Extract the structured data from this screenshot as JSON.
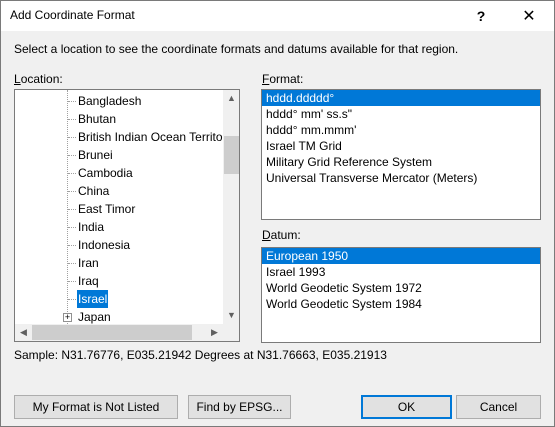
{
  "window": {
    "title": "Add Coordinate Format",
    "help": "?",
    "close": "✕"
  },
  "instruction": "Select a location to see the coordinate formats and datums available for that region.",
  "location": {
    "label_mnemonic": "L",
    "label_rest": "ocation:",
    "items": [
      {
        "label": "Bangladesh",
        "selected": false,
        "expandable": false
      },
      {
        "label": "Bhutan",
        "selected": false,
        "expandable": false
      },
      {
        "label": "British Indian Ocean Territo",
        "selected": false,
        "expandable": false
      },
      {
        "label": "Brunei",
        "selected": false,
        "expandable": false
      },
      {
        "label": "Cambodia",
        "selected": false,
        "expandable": false
      },
      {
        "label": "China",
        "selected": false,
        "expandable": false
      },
      {
        "label": "East Timor",
        "selected": false,
        "expandable": false
      },
      {
        "label": "India",
        "selected": false,
        "expandable": false
      },
      {
        "label": "Indonesia",
        "selected": false,
        "expandable": false
      },
      {
        "label": "Iran",
        "selected": false,
        "expandable": false
      },
      {
        "label": "Iraq",
        "selected": false,
        "expandable": false
      },
      {
        "label": "Israel",
        "selected": true,
        "expandable": false
      },
      {
        "label": "Japan",
        "selected": false,
        "expandable": true
      }
    ],
    "expander_glyph": "+",
    "scroll_up": "▲",
    "scroll_down": "▼",
    "scroll_left": "◀",
    "scroll_right": "▶"
  },
  "format": {
    "label_mnemonic": "F",
    "label_rest": "ormat:",
    "items": [
      {
        "label": "hddd.ddddd°",
        "selected": true
      },
      {
        "label": "hddd° mm' ss.s\"",
        "selected": false
      },
      {
        "label": "hddd° mm.mmm'",
        "selected": false
      },
      {
        "label": "Israel TM Grid",
        "selected": false
      },
      {
        "label": "Military Grid Reference System",
        "selected": false
      },
      {
        "label": "Universal Transverse Mercator (Meters)",
        "selected": false
      }
    ]
  },
  "datum": {
    "label_mnemonic": "D",
    "label_rest": "atum:",
    "items": [
      {
        "label": "European 1950",
        "selected": true
      },
      {
        "label": "Israel 1993",
        "selected": false
      },
      {
        "label": "World Geodetic System 1972",
        "selected": false
      },
      {
        "label": "World Geodetic System 1984",
        "selected": false
      }
    ]
  },
  "sample": "Sample: N31.76776, E035.21942 Degrees at N31.76663, E035.21913",
  "buttons": {
    "not_listed": "My Format is Not Listed",
    "find_epsg": "Find by EPSG...",
    "ok": "OK",
    "cancel": "Cancel"
  },
  "colors": {
    "selection": "#0078d7",
    "dialog_bg": "#f0f0f0"
  }
}
